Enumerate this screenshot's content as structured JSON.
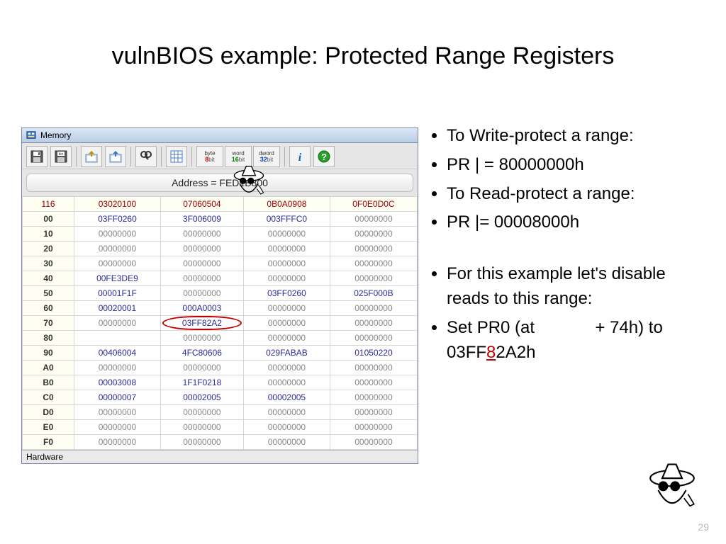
{
  "title": "vulnBIOS example: Protected Range Registers",
  "memwin": {
    "caption": "Memory",
    "toolbar": {
      "size_buttons": [
        {
          "label": "byte",
          "bits": "8",
          "color": "#c00000"
        },
        {
          "label": "word",
          "bits": "16",
          "color": "#008000"
        },
        {
          "label": "dword",
          "bits": "32",
          "color": "#0040c0"
        }
      ]
    },
    "address_label": "Address = FED1B800",
    "header": [
      "116",
      "03020100",
      "07060504",
      "0B0A0908",
      "0F0E0D0C"
    ],
    "rows": [
      {
        "ofs": "00",
        "v": [
          "03FF0260",
          "3F006009",
          "003FFFC0",
          "00000000"
        ]
      },
      {
        "ofs": "10",
        "v": [
          "00000000",
          "00000000",
          "00000000",
          "00000000"
        ]
      },
      {
        "ofs": "20",
        "v": [
          "00000000",
          "00000000",
          "00000000",
          "00000000"
        ]
      },
      {
        "ofs": "30",
        "v": [
          "00000000",
          "00000000",
          "00000000",
          "00000000"
        ]
      },
      {
        "ofs": "40",
        "v": [
          "00FE3DE9",
          "00000000",
          "00000000",
          "00000000"
        ]
      },
      {
        "ofs": "50",
        "v": [
          "00001F1F",
          "00000000",
          "03FF0260",
          "025F000B"
        ]
      },
      {
        "ofs": "60",
        "v": [
          "00020001",
          "000A0003",
          "00000000",
          "00000000"
        ]
      },
      {
        "ofs": "70",
        "v": [
          "00000000",
          "03FF82A2",
          "00000000",
          "00000000"
        ]
      },
      {
        "ofs": "80",
        "v": [
          "",
          "00000000",
          "00000000",
          "00000000"
        ]
      },
      {
        "ofs": "90",
        "v": [
          "00406004",
          "4FC80606",
          "029FABAB",
          "01050220"
        ]
      },
      {
        "ofs": "A0",
        "v": [
          "00000000",
          "00000000",
          "00000000",
          "00000000"
        ]
      },
      {
        "ofs": "B0",
        "v": [
          "00003008",
          "1F1F0218",
          "00000000",
          "00000000"
        ]
      },
      {
        "ofs": "C0",
        "v": [
          "00000007",
          "00002005",
          "00002005",
          "00000000"
        ]
      },
      {
        "ofs": "D0",
        "v": [
          "00000000",
          "00000000",
          "00000000",
          "00000000"
        ]
      },
      {
        "ofs": "E0",
        "v": [
          "00000000",
          "00000000",
          "00000000",
          "00000000"
        ]
      },
      {
        "ofs": "F0",
        "v": [
          "00000000",
          "00000000",
          "00000000",
          "00000000"
        ]
      }
    ],
    "circled": {
      "row": 7,
      "col": 1
    },
    "footer": "Hardware"
  },
  "bullets": {
    "b1": "To Write-protect a range:",
    "b2": "PR | = 80000000h",
    "b3": "To Read-protect a range:",
    "b4": "PR |= 00008000h",
    "b5": "For this example let's disable reads to this range:",
    "b6_pre": "Set PR0 (at ",
    "b6_mid": " + 74h) to 03FF",
    "b6_red": "8",
    "b6_post": "2A2h"
  },
  "page_number": "29"
}
